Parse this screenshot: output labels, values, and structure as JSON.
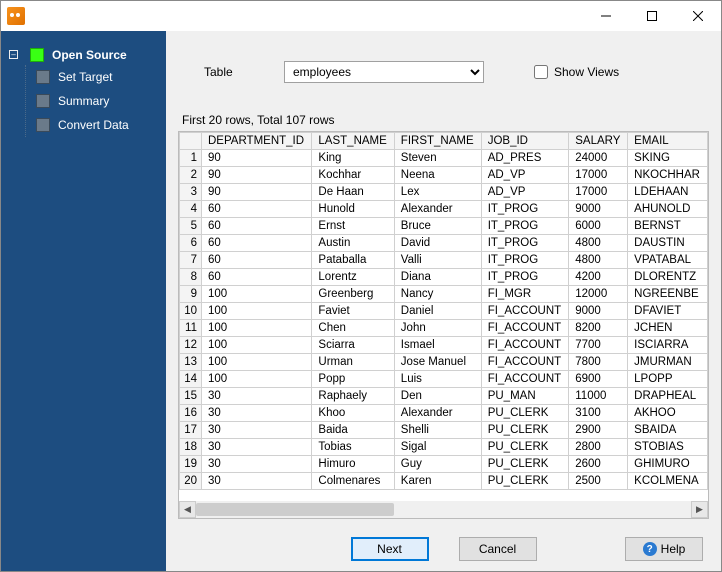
{
  "sidebar": {
    "root": {
      "label": "Open Source",
      "active": true
    },
    "children": [
      {
        "label": "Set Target"
      },
      {
        "label": "Summary"
      },
      {
        "label": "Convert Data"
      }
    ]
  },
  "form": {
    "table_label": "Table",
    "table_value": "employees",
    "show_views_label": "Show Views",
    "show_views_checked": false
  },
  "status_text": "First 20 rows, Total 107 rows",
  "columns": [
    "DEPARTMENT_ID",
    "LAST_NAME",
    "FIRST_NAME",
    "JOB_ID",
    "SALARY",
    "EMAIL"
  ],
  "rows": [
    {
      "n": 1,
      "DEPARTMENT_ID": "90",
      "LAST_NAME": "King",
      "FIRST_NAME": "Steven",
      "JOB_ID": "AD_PRES",
      "SALARY": "24000",
      "EMAIL": "SKING"
    },
    {
      "n": 2,
      "DEPARTMENT_ID": "90",
      "LAST_NAME": "Kochhar",
      "FIRST_NAME": "Neena",
      "JOB_ID": "AD_VP",
      "SALARY": "17000",
      "EMAIL": "NKOCHHAR"
    },
    {
      "n": 3,
      "DEPARTMENT_ID": "90",
      "LAST_NAME": "De Haan",
      "FIRST_NAME": "Lex",
      "JOB_ID": "AD_VP",
      "SALARY": "17000",
      "EMAIL": "LDEHAAN"
    },
    {
      "n": 4,
      "DEPARTMENT_ID": "60",
      "LAST_NAME": "Hunold",
      "FIRST_NAME": "Alexander",
      "JOB_ID": "IT_PROG",
      "SALARY": "9000",
      "EMAIL": "AHUNOLD"
    },
    {
      "n": 5,
      "DEPARTMENT_ID": "60",
      "LAST_NAME": "Ernst",
      "FIRST_NAME": "Bruce",
      "JOB_ID": "IT_PROG",
      "SALARY": "6000",
      "EMAIL": "BERNST"
    },
    {
      "n": 6,
      "DEPARTMENT_ID": "60",
      "LAST_NAME": "Austin",
      "FIRST_NAME": "David",
      "JOB_ID": "IT_PROG",
      "SALARY": "4800",
      "EMAIL": "DAUSTIN"
    },
    {
      "n": 7,
      "DEPARTMENT_ID": "60",
      "LAST_NAME": "Pataballa",
      "FIRST_NAME": "Valli",
      "JOB_ID": "IT_PROG",
      "SALARY": "4800",
      "EMAIL": "VPATABAL"
    },
    {
      "n": 8,
      "DEPARTMENT_ID": "60",
      "LAST_NAME": "Lorentz",
      "FIRST_NAME": "Diana",
      "JOB_ID": "IT_PROG",
      "SALARY": "4200",
      "EMAIL": "DLORENTZ"
    },
    {
      "n": 9,
      "DEPARTMENT_ID": "100",
      "LAST_NAME": "Greenberg",
      "FIRST_NAME": "Nancy",
      "JOB_ID": "FI_MGR",
      "SALARY": "12000",
      "EMAIL": "NGREENBE"
    },
    {
      "n": 10,
      "DEPARTMENT_ID": "100",
      "LAST_NAME": "Faviet",
      "FIRST_NAME": "Daniel",
      "JOB_ID": "FI_ACCOUNT",
      "SALARY": "9000",
      "EMAIL": "DFAVIET"
    },
    {
      "n": 11,
      "DEPARTMENT_ID": "100",
      "LAST_NAME": "Chen",
      "FIRST_NAME": "John",
      "JOB_ID": "FI_ACCOUNT",
      "SALARY": "8200",
      "EMAIL": "JCHEN"
    },
    {
      "n": 12,
      "DEPARTMENT_ID": "100",
      "LAST_NAME": "Sciarra",
      "FIRST_NAME": "Ismael",
      "JOB_ID": "FI_ACCOUNT",
      "SALARY": "7700",
      "EMAIL": "ISCIARRA"
    },
    {
      "n": 13,
      "DEPARTMENT_ID": "100",
      "LAST_NAME": "Urman",
      "FIRST_NAME": "Jose Manuel",
      "JOB_ID": "FI_ACCOUNT",
      "SALARY": "7800",
      "EMAIL": "JMURMAN"
    },
    {
      "n": 14,
      "DEPARTMENT_ID": "100",
      "LAST_NAME": "Popp",
      "FIRST_NAME": "Luis",
      "JOB_ID": "FI_ACCOUNT",
      "SALARY": "6900",
      "EMAIL": "LPOPP"
    },
    {
      "n": 15,
      "DEPARTMENT_ID": "30",
      "LAST_NAME": "Raphaely",
      "FIRST_NAME": "Den",
      "JOB_ID": "PU_MAN",
      "SALARY": "11000",
      "EMAIL": "DRAPHEAL"
    },
    {
      "n": 16,
      "DEPARTMENT_ID": "30",
      "LAST_NAME": "Khoo",
      "FIRST_NAME": "Alexander",
      "JOB_ID": "PU_CLERK",
      "SALARY": "3100",
      "EMAIL": "AKHOO"
    },
    {
      "n": 17,
      "DEPARTMENT_ID": "30",
      "LAST_NAME": "Baida",
      "FIRST_NAME": "Shelli",
      "JOB_ID": "PU_CLERK",
      "SALARY": "2900",
      "EMAIL": "SBAIDA"
    },
    {
      "n": 18,
      "DEPARTMENT_ID": "30",
      "LAST_NAME": "Tobias",
      "FIRST_NAME": "Sigal",
      "JOB_ID": "PU_CLERK",
      "SALARY": "2800",
      "EMAIL": "STOBIAS"
    },
    {
      "n": 19,
      "DEPARTMENT_ID": "30",
      "LAST_NAME": "Himuro",
      "FIRST_NAME": "Guy",
      "JOB_ID": "PU_CLERK",
      "SALARY": "2600",
      "EMAIL": "GHIMURO"
    },
    {
      "n": 20,
      "DEPARTMENT_ID": "30",
      "LAST_NAME": "Colmenares",
      "FIRST_NAME": "Karen",
      "JOB_ID": "PU_CLERK",
      "SALARY": "2500",
      "EMAIL": "KCOLMENA"
    }
  ],
  "buttons": {
    "next": "Next",
    "cancel": "Cancel",
    "help": "Help"
  }
}
